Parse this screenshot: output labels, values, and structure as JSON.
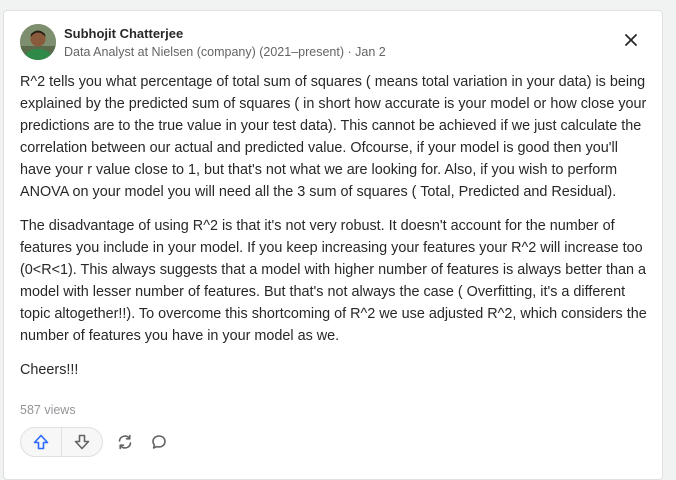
{
  "post": {
    "author": {
      "name": "Subhojit Chatterjee",
      "meta": "Data Analyst at Nielsen (company) (2021–present) · Jan 2"
    },
    "paragraphs": [
      "R^2 tells you what percentage of total sum of squares ( means total variation in your data) is being explained by the predicted sum of squares ( in short how accurate is your model or how close your predictions are to the true value in your test data). This cannot be achieved if we just calculate the correlation between our actual and predicted value. Ofcourse, if your model is good then you'll have your r value close to 1, but that's not what we are looking for. Also, if you wish to perform ANOVA on your model you will need all the 3 sum of squares ( Total, Predicted and Residual).",
      "The disadvantage of using R^2 is that it's not very robust. It doesn't account for the number of features you include in your model. If you keep increasing your features your R^2 will increase too (0<R<1). This always suggests that a model with higher number of features is always better than a model with lesser number of features. But that's not always the case ( Overfitting, it's a different topic altogether!!). To overcome this shortcoming of R^2 we use adjusted R^2, which considers the number of features you have in your model as we.",
      "Cheers!!!"
    ],
    "views": "587 views"
  },
  "icons": {
    "close": "close-icon",
    "upvote": "arrow-up-icon",
    "downvote": "arrow-down-icon",
    "share": "share-icon",
    "comment": "comment-icon"
  },
  "colors": {
    "accent": "#2e69ff",
    "icon": "#636466",
    "text": "#282829",
    "muted": "#939598"
  }
}
